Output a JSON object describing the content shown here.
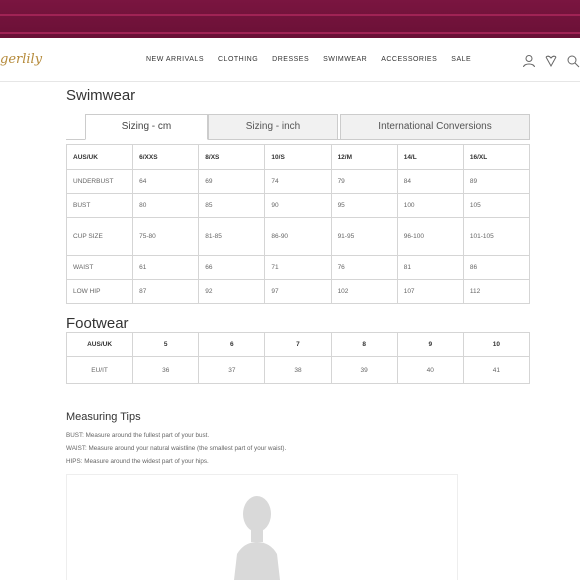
{
  "header": {
    "logo_text": "gerlily",
    "nav": [
      "NEW ARRIVALS",
      "CLOTHING",
      "DRESSES",
      "SWIMWEAR",
      "ACCESSORIES",
      "SALE"
    ],
    "icons": [
      "user-icon",
      "heart-icon",
      "search-icon"
    ]
  },
  "swimwear": {
    "title": "Swimwear",
    "tabs": [
      "Sizing - cm",
      "Sizing - inch",
      "International Conversions"
    ],
    "active_tab": "Sizing - cm",
    "headers": [
      "AUS/UK",
      "6/XXS",
      "8/XS",
      "10/S",
      "12/M",
      "14/L",
      "16/XL"
    ],
    "rows": [
      [
        "UNDERBUST",
        "64",
        "69",
        "74",
        "79",
        "84",
        "89"
      ],
      [
        "BUST",
        "80",
        "85",
        "90",
        "95",
        "100",
        "105"
      ],
      [
        "CUP SIZE",
        "75-80",
        "81-85",
        "86-90",
        "91-95",
        "96-100",
        "101-105"
      ],
      [
        "WAIST",
        "61",
        "66",
        "71",
        "76",
        "81",
        "86"
      ],
      [
        "LOW HIP",
        "87",
        "92",
        "97",
        "102",
        "107",
        "112"
      ]
    ]
  },
  "footwear": {
    "title": "Footwear",
    "headers": [
      "AUS/UK",
      "5",
      "6",
      "7",
      "8",
      "9",
      "10"
    ],
    "rows": [
      [
        "EU/IT",
        "36",
        "37",
        "38",
        "39",
        "40",
        "41"
      ]
    ]
  },
  "tips": {
    "title": "Measuring Tips",
    "bust": "BUST: Measure around the fullest part of your bust.",
    "waist": "WAIST: Measure around your natural waistline (the smallest part of your waist).",
    "hips": "HIPS: Measure around the widest part of your hips."
  },
  "colors": {
    "banner": "#6a1036",
    "logo": "#b58a3a"
  }
}
